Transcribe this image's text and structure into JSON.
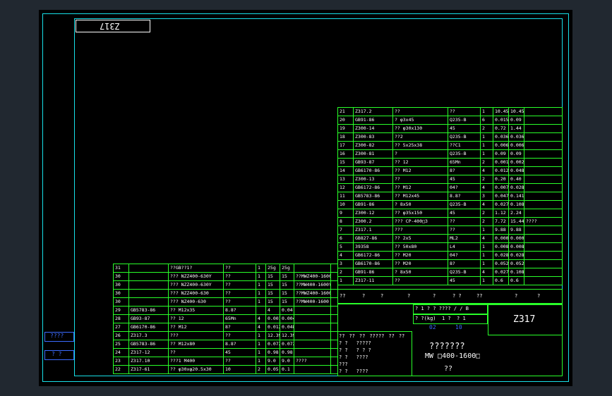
{
  "drawing": {
    "mirrored_code": "Z317",
    "title_code": "Z317",
    "title_main": "???????",
    "title_spec": "MW □400-1600□",
    "title_bottom": "??",
    "side_labels": [
      "????",
      "?  ?"
    ],
    "colors": {
      "frame": "#17e0e8",
      "grid": "#29ff29",
      "text": "#ffffff",
      "accent": "#3b6bff",
      "background": "#000000"
    }
  },
  "right_table": [
    [
      "21",
      "Z317.2",
      "??",
      "??",
      "1",
      "10.45",
      "10.45",
      ""
    ],
    [
      "20",
      "GB91-86",
      "? φ3x45",
      "Q235-B",
      "6",
      "0.015",
      "0.09",
      ""
    ],
    [
      "19",
      "Z300-14",
      "?? φ30x130",
      "45",
      "2",
      "0.72",
      "1.44",
      ""
    ],
    [
      "18",
      "Z300-83",
      "??2",
      "Q235-B",
      "1",
      "0.036",
      "0.036",
      ""
    ],
    [
      "17",
      "Z300-82",
      "?? 5x25x38",
      "??C1",
      "1",
      "0.0065",
      "0.0065",
      ""
    ],
    [
      "16",
      "Z300-81",
      "?",
      "Q235-B",
      "1",
      "0.09",
      "0.09",
      ""
    ],
    [
      "15",
      "GB93-87",
      "?? 12",
      "65Mn",
      "2",
      "0.0012",
      "0.0024",
      ""
    ],
    [
      "14",
      "GB6170-86",
      "?? M12",
      "8?",
      "4",
      "0.012",
      "0.048",
      ""
    ],
    [
      "13",
      "Z300-13",
      "??",
      "45",
      "2",
      "0.20",
      "0.40",
      ""
    ],
    [
      "12",
      "GB6172-86",
      "?? M12",
      "04?",
      "4",
      "0.007",
      "0.028",
      ""
    ],
    [
      "11",
      "GB5783-86",
      "?? M12x45",
      "8.8?",
      "3",
      "0.047",
      "0.141",
      ""
    ],
    [
      "10",
      "GB91-86",
      "? 8x50",
      "Q235-B",
      "4",
      "0.027",
      "0.108",
      ""
    ],
    [
      "9",
      "Z300-12",
      "?? φ35x150",
      "45",
      "2",
      "1.12",
      "2.24",
      ""
    ],
    [
      "8",
      "Z300.2",
      "??? CP-400□3",
      "??",
      "2",
      "7.72",
      "15.44",
      "????"
    ],
    [
      "7",
      "Z317.1",
      "???",
      "??",
      "1",
      "9.88",
      "9.88",
      ""
    ],
    [
      "6",
      "GB827-86",
      "?? 2x5",
      "ML2",
      "4",
      "0.0002",
      "0.0008",
      ""
    ],
    [
      "5",
      "39358",
      "?? 50x80",
      "L4",
      "1",
      "0.008",
      "0.008",
      ""
    ],
    [
      "4",
      "GB6172-86",
      "?? M20",
      "04?",
      "1",
      "0.028",
      "0.028",
      ""
    ],
    [
      "3",
      "GB6170-86",
      "?? M20",
      "8?",
      "1",
      "0.052",
      "0.052",
      ""
    ],
    [
      "2",
      "GB91-86",
      "? 8x50",
      "Q235-B",
      "4",
      "0.027",
      "0.108",
      ""
    ],
    [
      "1",
      "Z317-11",
      "??",
      "45",
      "1",
      "0.6",
      "0.6",
      ""
    ]
  ],
  "right_header": [
    "??",
    "?",
    "?",
    "?",
    "?",
    "? ?",
    "??",
    "?",
    "?"
  ],
  "left_table": [
    [
      "31",
      "",
      "??GB??1?",
      "??",
      "1",
      "25g",
      "25g",
      "",
      ""
    ],
    [
      "30",
      "",
      "??? NZZ400-630Y",
      "??",
      "1",
      "15",
      "15",
      "??MWZ400-1600Y",
      ""
    ],
    [
      "30",
      "",
      "??? NZZ400-630Y",
      "??",
      "1",
      "15",
      "15",
      "??MW400-1600Y",
      ""
    ],
    [
      "30",
      "",
      "??? NZZ400-630",
      "??",
      "1",
      "15",
      "15",
      "??MWZ400-1600",
      ""
    ],
    [
      "30",
      "",
      "??? NZ400-630",
      "??",
      "1",
      "15",
      "15",
      "??MW400-1600",
      ""
    ],
    [
      "29",
      "GB5783-86",
      "?? M12x35",
      "8.8?",
      "",
      "4",
      "0.04",
      "",
      ""
    ],
    [
      "28",
      "GB93-87",
      "?? 12",
      "65Mn",
      "4",
      "0.0012",
      "0.0048",
      "",
      ""
    ],
    [
      "27",
      "GB6170-86",
      "?? M12",
      "8?",
      "4",
      "0.012",
      "0.048",
      "",
      ""
    ],
    [
      "26",
      "Z317.3",
      "???",
      "??",
      "1",
      "12.39",
      "12.39",
      "",
      ""
    ],
    [
      "25",
      "GB5783-86",
      "?? M12x80",
      "8.8?",
      "1",
      "0.072",
      "0.072",
      "",
      ""
    ],
    [
      "24",
      "Z317-12",
      "??",
      "45",
      "1",
      "0.98",
      "0.98",
      "",
      ""
    ],
    [
      "23",
      "Z317.10",
      "???1 M400",
      "??",
      "1",
      "9.0",
      "9.0",
      "????",
      ""
    ],
    [
      "22",
      "Z317-61",
      "?? φ30xφ20.5x30",
      "10",
      "2",
      "0.05",
      "0.1",
      "",
      ""
    ]
  ],
  "title_block": {
    "row_a": [
      "? 1",
      "? ?",
      "????",
      "/",
      "/",
      "B"
    ],
    "row_b": [
      "? ?(kg)",
      "1 ?",
      "? 1"
    ],
    "row_c": [
      "02",
      "10"
    ],
    "sig_rows": [
      [
        "??",
        "??",
        "??",
        "?????",
        "??",
        "??"
      ],
      [
        "? ?",
        "",
        "?????"
      ],
      [
        "? ?",
        "",
        "? ? ?"
      ],
      [
        "? ?",
        "",
        "????"
      ],
      [
        "???",
        "",
        ""
      ],
      [
        "? ?",
        "",
        "????"
      ]
    ],
    "weight_label": "? ?(kg)",
    "scale": "1 : ?"
  }
}
